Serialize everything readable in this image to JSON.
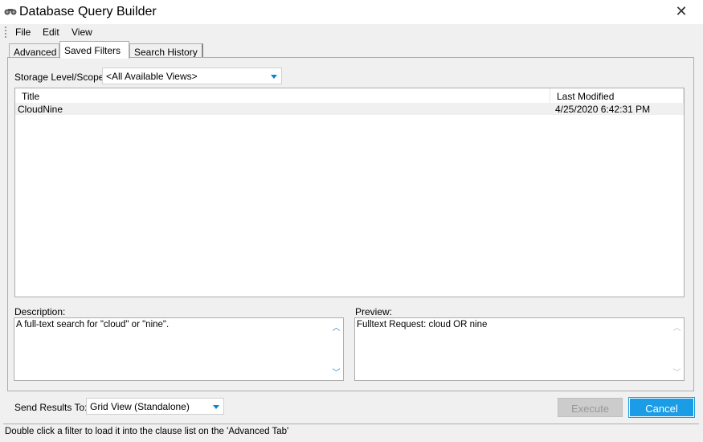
{
  "window": {
    "title": "Database Query Builder",
    "icon": "binoculars-icon"
  },
  "menu": [
    "File",
    "Edit",
    "View"
  ],
  "tabs": [
    {
      "label": "Advanced"
    },
    {
      "label": "Saved Filters",
      "active": true
    },
    {
      "label": "Search History"
    }
  ],
  "scope": {
    "label": "Storage Level/Scope:",
    "value": "<All Available Views>"
  },
  "list": {
    "columns": [
      "Title",
      "Last Modified"
    ],
    "rows": [
      {
        "title": "CloudNine",
        "modified": "4/25/2020 6:42:31 PM"
      }
    ]
  },
  "description": {
    "label": "Description:",
    "value": "A full-text search for \"cloud\" or \"nine\"."
  },
  "preview": {
    "label": "Preview:",
    "value": "Fulltext Request: cloud OR nine"
  },
  "send": {
    "label": "Send Results To:",
    "value": "Grid View (Standalone)"
  },
  "buttons": {
    "execute": "Execute",
    "cancel": "Cancel"
  },
  "status": "Double click a filter to load it into the clause list on the 'Advanced Tab'",
  "colors": {
    "accent": "#1a9de6"
  }
}
